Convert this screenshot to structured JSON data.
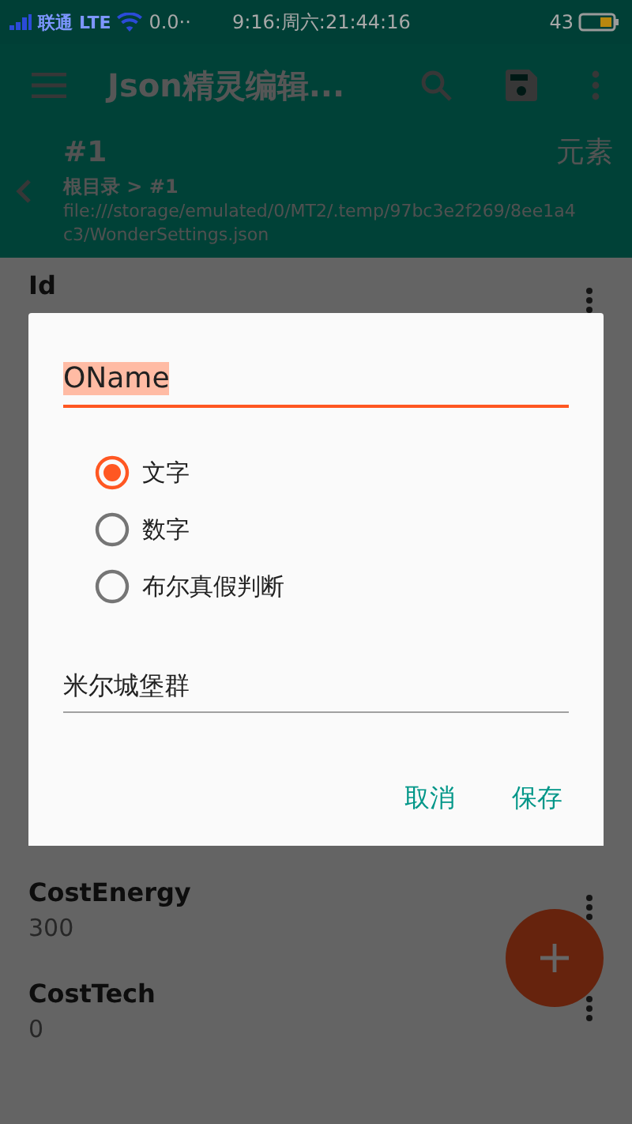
{
  "status_bar": {
    "carrier": "联通",
    "network": "LTE",
    "speed": "0.0··",
    "clock": "9:16:周六:21:44:16",
    "battery": "43"
  },
  "toolbar": {
    "title": "Json精灵编辑..."
  },
  "header": {
    "title": "#1",
    "breadcrumb": "根目录 > #1",
    "path": "file:///storage/emulated/0/MT2/.temp/97bc3e2f269/8ee1a4c3/WonderSettings.json",
    "type": "元素"
  },
  "items": [
    {
      "name": "Id"
    },
    {
      "name": "CostEnergy",
      "value": "300"
    },
    {
      "name": "CostTech",
      "value": "0"
    }
  ],
  "dialog": {
    "key_field": {
      "value": "OName",
      "focused": true
    },
    "types": [
      {
        "label": "文字",
        "selected": true
      },
      {
        "label": "数字",
        "selected": false
      },
      {
        "label": "布尔真假判断",
        "selected": false
      }
    ],
    "value_field": {
      "value": "米尔城堡群",
      "focused": false
    },
    "buttons": [
      "取消",
      "保存"
    ]
  }
}
